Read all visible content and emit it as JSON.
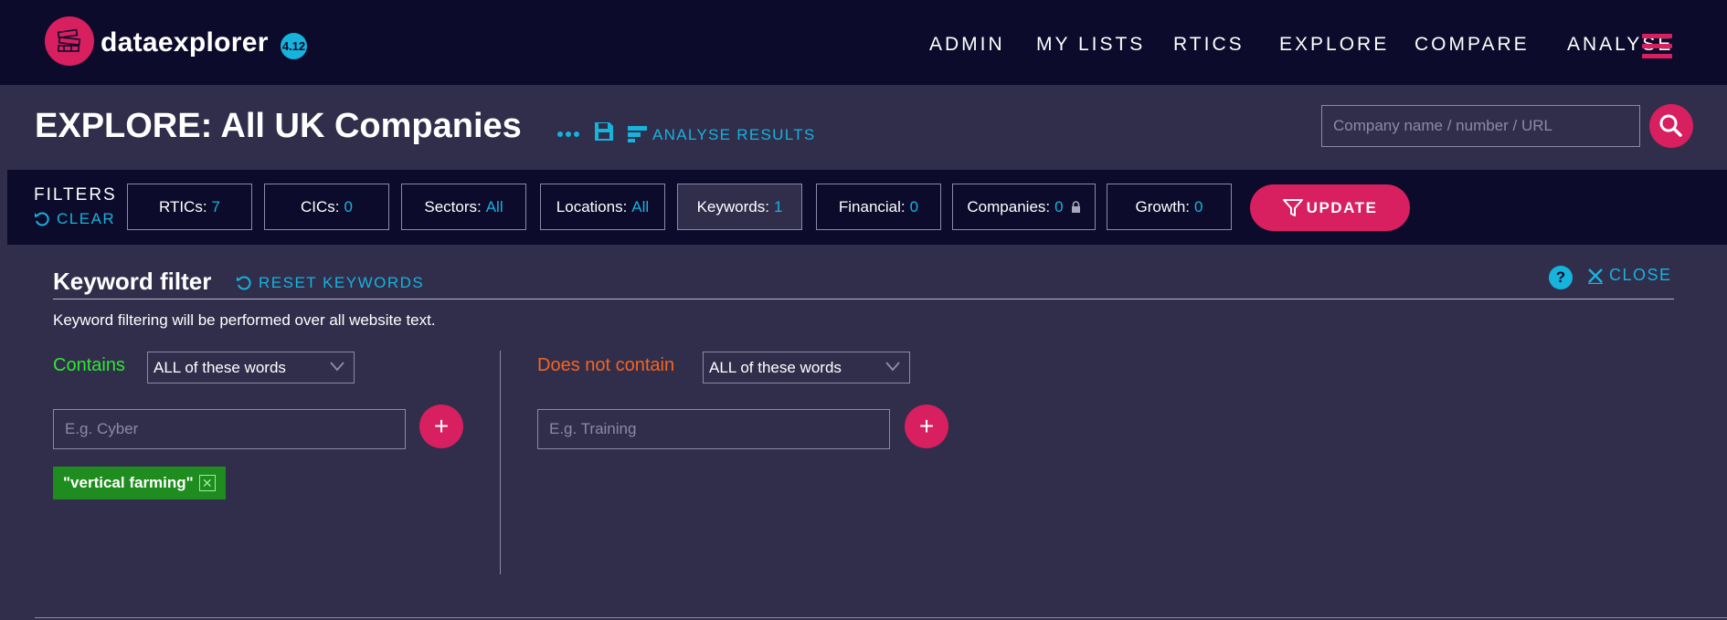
{
  "app": {
    "name": "dataexplorer",
    "version": "4.12",
    "logo_icon": "crate-stack-icon"
  },
  "nav": {
    "items": [
      "ADMIN",
      "MY LISTS",
      "RTICS",
      "EXPLORE",
      "COMPARE",
      "ANALYSE"
    ],
    "menu_icon": "hamburger-icon"
  },
  "header": {
    "title": "EXPLORE: All UK Companies",
    "analyse_label": "ANALYSE RESULTS",
    "search_placeholder": "Company name / number / URL"
  },
  "filters": {
    "label": "FILTERS",
    "clear_label": "CLEAR",
    "items": [
      {
        "label": "RTICs:",
        "value": "7"
      },
      {
        "label": "CICs:",
        "value": "0"
      },
      {
        "label": "Sectors:",
        "value": "All"
      },
      {
        "label": "Locations:",
        "value": "All"
      },
      {
        "label": "Keywords:",
        "value": "1",
        "active": true
      },
      {
        "label": "Financial:",
        "value": "0"
      },
      {
        "label": "Companies:",
        "value": "0",
        "locked": true
      },
      {
        "label": "Growth:",
        "value": "0"
      }
    ],
    "update_label": "UPDATE"
  },
  "keyword_filter": {
    "title": "Keyword filter",
    "reset_label": "RESET KEYWORDS",
    "help_label": "?",
    "close_label": "CLOSE",
    "description": "Keyword filtering will be performed over all website text.",
    "contains": {
      "label": "Contains",
      "mode": "ALL of these words",
      "placeholder": "E.g. Cyber",
      "tags": [
        "\"vertical farming\""
      ]
    },
    "not_contains": {
      "label": "Does not contain",
      "mode": "ALL of these words",
      "placeholder": "E.g. Training"
    },
    "add_label": "+"
  },
  "colors": {
    "bg": "#312e4c",
    "nav": "#0d0b2b",
    "accent": "#d81f5f",
    "link": "#16b3dc",
    "contains": "#2ee82e",
    "not_contains": "#f26522",
    "tag": "#1e8c1e"
  }
}
